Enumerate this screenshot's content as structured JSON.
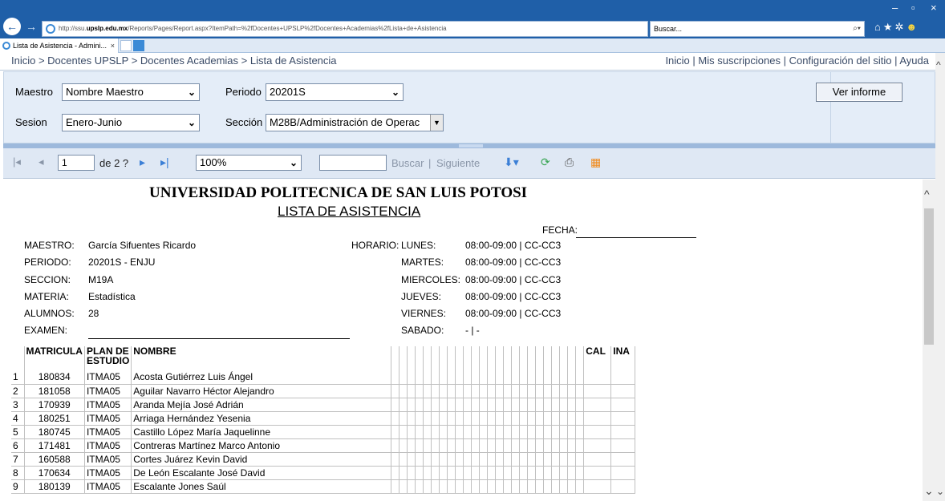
{
  "browser": {
    "url_prefix": "http://ssu.",
    "url_domain": "upslp.edu.mx",
    "url_rest": "/Reports/Pages/Report.aspx?ItemPath=%2fDocentes+UPSLP%2fDocentes+Academias%2fLista+de+Asistencia",
    "search_placeholder": "Buscar...",
    "tab_title": "Lista de Asistencia - Admini...",
    "tab_close": "×"
  },
  "breadcrumb": "Inicio > Docentes UPSLP > Docentes Academias > Lista de Asistencia",
  "top_links": "Inicio | Mis suscripciones | Configuración del sitio | Ayuda",
  "params": {
    "maestro_label": "Maestro",
    "maestro_value": "Nombre Maestro",
    "periodo_label": "Periodo",
    "periodo_value": "20201S",
    "sesion_label": "Sesion",
    "sesion_value": "Enero-Junio",
    "seccion_label": "Sección",
    "seccion_value": "M28B/Administración de Operac",
    "view_button": "Ver informe"
  },
  "toolbar": {
    "page_value": "1",
    "page_of": "de 2 ?",
    "zoom_value": "100%",
    "find_label": "Buscar",
    "separator": "|",
    "next_label": "Siguiente"
  },
  "report": {
    "title": "UNIVERSIDAD POLITECNICA DE SAN LUIS POTOSI",
    "subtitle": "LISTA DE ASISTENCIA",
    "fecha_label": "FECHA:",
    "maestro_label": "MAESTRO:",
    "maestro_value": "García Sifuentes Ricardo",
    "periodo_label": "PERIODO:",
    "periodo_value": "20201S - ENJU",
    "seccion_label": "SECCION:",
    "seccion_value": "M19A",
    "materia_label": "MATERIA:",
    "materia_value": "Estadística",
    "alumnos_label": "ALUMNOS:",
    "alumnos_value": "28",
    "examen_label": "EXAMEN:",
    "horario_label": "HORARIO:",
    "days": [
      {
        "day": "LUNES:",
        "time": "08:00-09:00 | CC-CC3"
      },
      {
        "day": "MARTES:",
        "time": "08:00-09:00 | CC-CC3"
      },
      {
        "day": "MIERCOLES:",
        "time": "08:00-09:00 | CC-CC3"
      },
      {
        "day": "JUEVES:",
        "time": "08:00-09:00 | CC-CC3"
      },
      {
        "day": "VIERNES:",
        "time": "08:00-09:00 | CC-CC3"
      },
      {
        "day": "SABADO:",
        "time": "- | -"
      }
    ],
    "columns": {
      "matricula": "MATRICULA",
      "plan": "PLAN DE ESTUDIO",
      "nombre": "NOMBRE",
      "cal": "CAL",
      "ina": "INA"
    },
    "students": [
      {
        "n": "1",
        "matricula": "180834",
        "plan": "ITMA05",
        "nombre": "Acosta Gutiérrez Luis Ángel"
      },
      {
        "n": "2",
        "matricula": "181058",
        "plan": "ITMA05",
        "nombre": "Aguilar Navarro Héctor Alejandro"
      },
      {
        "n": "3",
        "matricula": "170939",
        "plan": "ITMA05",
        "nombre": "Aranda Mejía José Adrián"
      },
      {
        "n": "4",
        "matricula": "180251",
        "plan": "ITMA05",
        "nombre": "Arriaga Hernández Yesenia"
      },
      {
        "n": "5",
        "matricula": "180745",
        "plan": "ITMA05",
        "nombre": "Castillo López María Jaquelinne"
      },
      {
        "n": "6",
        "matricula": "171481",
        "plan": "ITMA05",
        "nombre": "Contreras Martínez Marco Antonio"
      },
      {
        "n": "7",
        "matricula": "160588",
        "plan": "ITMA05",
        "nombre": "Cortes Juárez Kevin David"
      },
      {
        "n": "8",
        "matricula": "170634",
        "plan": "ITMA05",
        "nombre": "De León Escalante José David"
      },
      {
        "n": "9",
        "matricula": "180139",
        "plan": "ITMA05",
        "nombre": "Escalante Jones Saúl"
      }
    ]
  },
  "colors": {
    "chrome": "#1f5fa8",
    "param_bg": "#e4edf8",
    "toolbar_bg": "#dfe8f4",
    "link": "#3a4b67"
  }
}
